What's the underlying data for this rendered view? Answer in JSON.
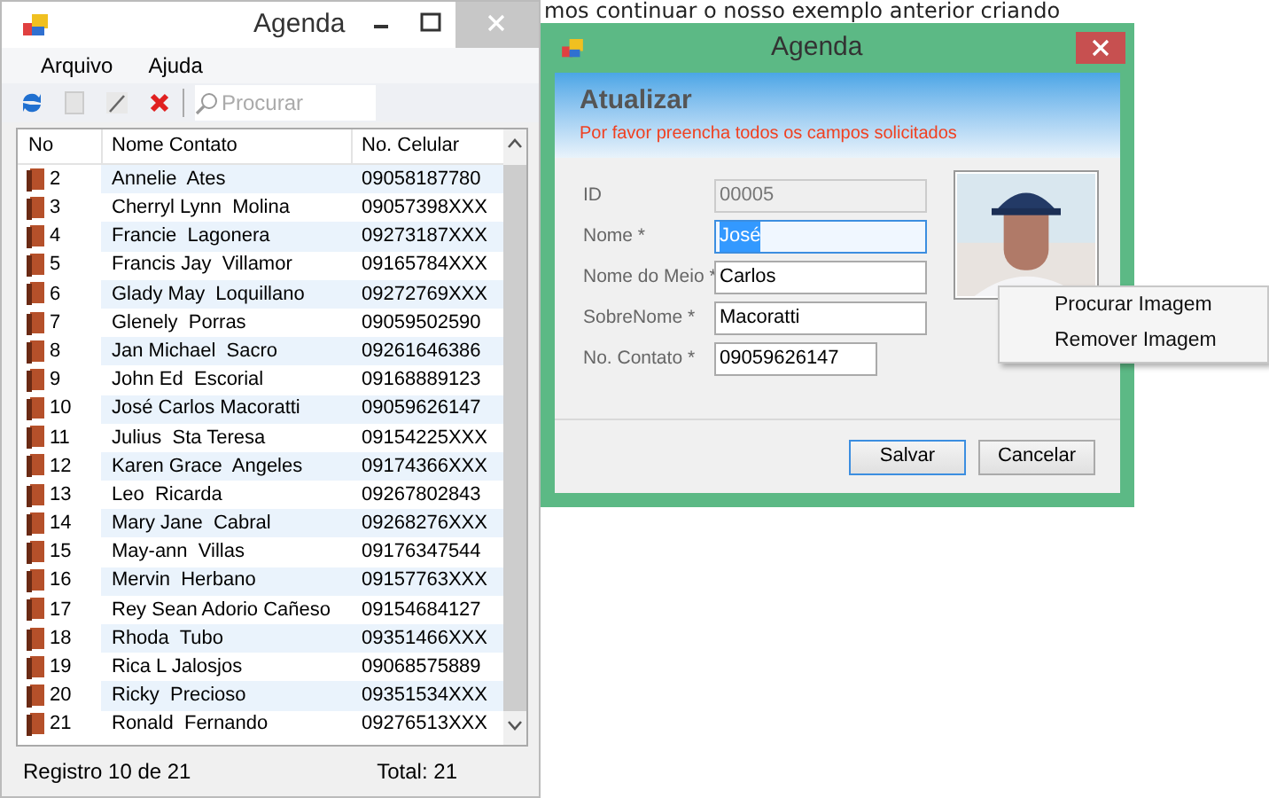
{
  "background_text": "mos continuar o nosso exemplo anterior criando",
  "main_window": {
    "title": "Agenda",
    "menu": [
      "Arquivo",
      "Ajuda"
    ],
    "search_placeholder": "Procurar",
    "columns": [
      "No",
      "Nome Contato",
      "No. Celular"
    ],
    "rows": [
      {
        "no": "2",
        "name": "Annelie  Ates",
        "phone": "09058187780"
      },
      {
        "no": "3",
        "name": "Cherryl Lynn  Molina",
        "phone": "09057398XXX"
      },
      {
        "no": "4",
        "name": "Francie  Lagonera",
        "phone": "09273187XXX"
      },
      {
        "no": "5",
        "name": "Francis Jay  Villamor",
        "phone": "09165784XXX"
      },
      {
        "no": "6",
        "name": "Glady May  Loquillano",
        "phone": "09272769XXX"
      },
      {
        "no": "7",
        "name": "Glenely  Porras",
        "phone": "09059502590"
      },
      {
        "no": "8",
        "name": "Jan Michael  Sacro",
        "phone": "09261646386"
      },
      {
        "no": "9",
        "name": "John Ed  Escorial",
        "phone": "09168889123"
      },
      {
        "no": "10",
        "name": "José Carlos Macoratti",
        "phone": "09059626147"
      },
      {
        "no": "11",
        "name": "Julius  Sta Teresa",
        "phone": "09154225XXX"
      },
      {
        "no": "12",
        "name": "Karen Grace  Angeles",
        "phone": "09174366XXX"
      },
      {
        "no": "13",
        "name": "Leo  Ricarda",
        "phone": "09267802843"
      },
      {
        "no": "14",
        "name": "Mary Jane  Cabral",
        "phone": "09268276XXX"
      },
      {
        "no": "15",
        "name": "May-ann  Villas",
        "phone": "09176347544"
      },
      {
        "no": "16",
        "name": "Mervin  Herbano",
        "phone": "09157763XXX"
      },
      {
        "no": "17",
        "name": "Rey Sean Adorio Cañeso",
        "phone": "09154684127"
      },
      {
        "no": "18",
        "name": "Rhoda  Tubo",
        "phone": "09351466XXX"
      },
      {
        "no": "19",
        "name": "Rica L Jalosjos",
        "phone": "09068575889"
      },
      {
        "no": "20",
        "name": "Ricky  Precioso",
        "phone": "09351534XXX"
      },
      {
        "no": "21",
        "name": "Ronald  Fernando",
        "phone": "09276513XXX"
      }
    ],
    "status_bar": {
      "record": "Registro 10 de 21",
      "total": "Total: 21"
    }
  },
  "dialog": {
    "title": "Agenda",
    "heading": "Atualizar",
    "subheading": "Por favor preencha todos os campos solicitados",
    "fields": [
      {
        "label": "ID",
        "value": "00005",
        "disabled": true,
        "text_selected": false
      },
      {
        "label": "Nome *",
        "value": "José",
        "disabled": false,
        "text_selected": true
      },
      {
        "label": "Nome do Meio *",
        "value": "Carlos",
        "disabled": false,
        "text_selected": false
      },
      {
        "label": "SobreNome *",
        "value": "Macoratti",
        "disabled": false,
        "text_selected": false
      },
      {
        "label": "No. Contato *",
        "value": "09059626147",
        "disabled": false,
        "text_selected": false
      }
    ],
    "buttons": [
      {
        "label": "Salvar",
        "default": true
      },
      {
        "label": "Cancelar",
        "default": false
      }
    ]
  },
  "context_menu": [
    "Procurar Imagem",
    "Remover Imagem"
  ]
}
